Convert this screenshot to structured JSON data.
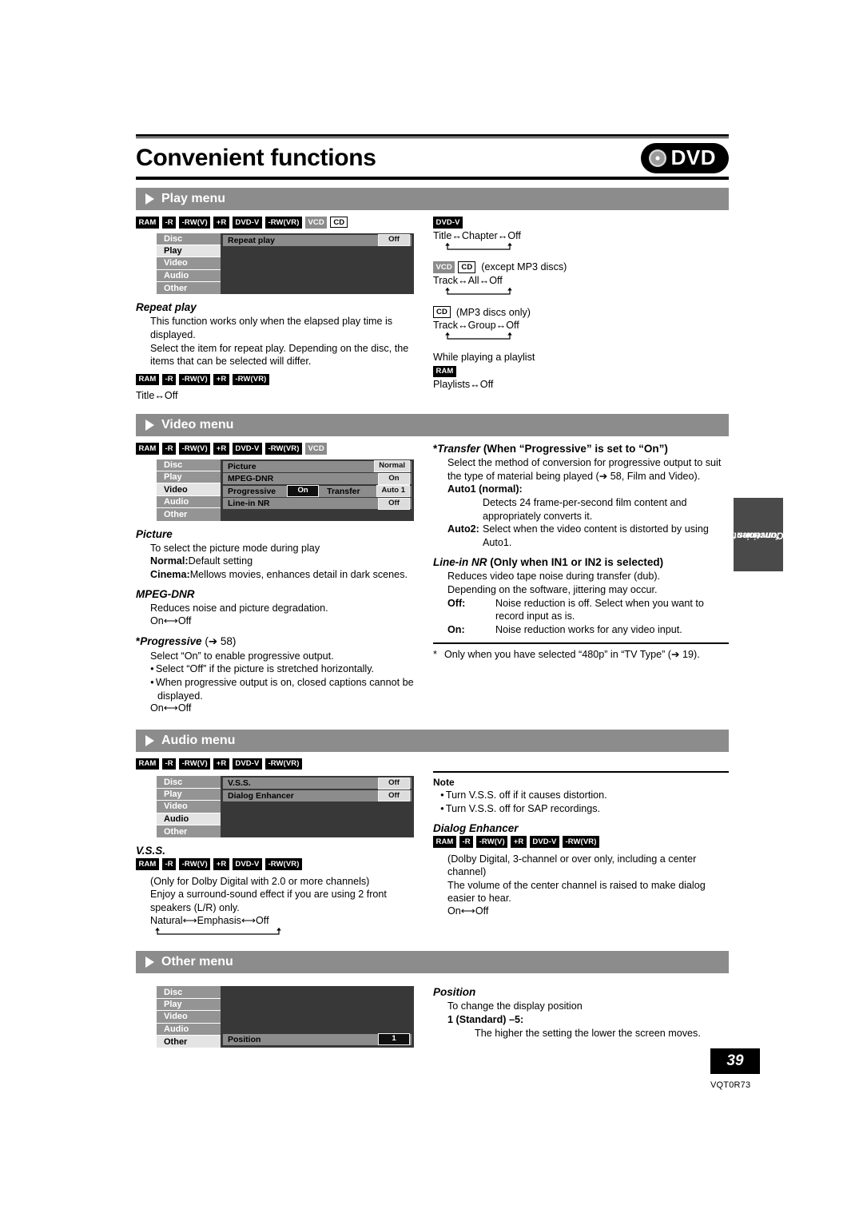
{
  "header": {
    "title": "Convenient functions",
    "logo_text": "DVD",
    "logo_icon": "disc-icon"
  },
  "badge_types": {
    "RAM": "dark",
    "-R": "dark",
    "-RW(V)": "dark",
    "+R": "dark",
    "DVD-V": "dark",
    "-RW(VR)": "dark",
    "VCD": "gray",
    "CD": "light"
  },
  "sections": [
    {
      "id": "play",
      "title": "Play menu",
      "badges": [
        "RAM",
        "-R",
        "-RW(V)",
        "+R",
        "DVD-V",
        "-RW(VR)",
        "VCD",
        "CD"
      ],
      "osd": {
        "tabs": [
          "Disc",
          "Play",
          "Video",
          "Audio",
          "Other"
        ],
        "active": "Play",
        "rows": [
          {
            "label": "Repeat play",
            "value": "Off",
            "value_style": "light"
          }
        ]
      },
      "left": {
        "term": "Repeat play",
        "paragraphs": [
          "This function works only when the elapsed play time is displayed.",
          "Select the item for repeat play. Depending on the disc, the items that can be selected will differ."
        ],
        "sub_badges": [
          "RAM",
          "-R",
          "-RW(V)",
          "+R",
          "-RW(VR)"
        ],
        "cycle": "Title↔Off"
      },
      "right": {
        "blocks": [
          {
            "badges": [
              "DVD-V"
            ],
            "note": "",
            "cycle": "Title↔Chapter↔Off",
            "loop": true
          },
          {
            "badges": [
              "VCD",
              "CD"
            ],
            "note": "(except MP3 discs)",
            "cycle": "Track↔All↔Off",
            "loop": true
          },
          {
            "badges": [
              "CD"
            ],
            "note": "(MP3 discs only)",
            "cycle": "Track↔Group↔Off",
            "loop": true
          },
          {
            "pretext": "While playing a playlist",
            "badges": [
              "RAM"
            ],
            "note": "",
            "cycle": "Playlists↔Off",
            "loop": false
          }
        ]
      }
    },
    {
      "id": "video",
      "title": "Video menu",
      "badges": [
        "RAM",
        "-R",
        "-RW(V)",
        "+R",
        "DVD-V",
        "-RW(VR)",
        "VCD"
      ],
      "osd": {
        "tabs": [
          "Disc",
          "Play",
          "Video",
          "Audio",
          "Other"
        ],
        "active": "Video",
        "rows": [
          {
            "label": "Picture",
            "value": "Normal",
            "value_style": "light"
          },
          {
            "label": "MPEG-DNR",
            "value": "On",
            "value_style": "light"
          },
          {
            "label": "Progressive",
            "value": "On",
            "value_style": "dark",
            "label2": "Transfer",
            "value2": "Auto 1",
            "value2_style": "light"
          },
          {
            "label": "Line-in NR",
            "value": "Off",
            "value_style": "light"
          }
        ]
      },
      "left": {
        "picture": {
          "term": "Picture",
          "intro": "To select the picture mode during play",
          "defs": [
            {
              "dt": "Normal:",
              "dd": "Default setting"
            },
            {
              "dt": "Cinema:",
              "dd": "Mellows movies, enhances detail in dark scenes."
            }
          ]
        },
        "mpeg": {
          "term": "MPEG-DNR",
          "text": "Reduces noise and picture degradation.",
          "cycle": "On⟷Off"
        },
        "progressive": {
          "term": "Progressive",
          "term_suffix": "(➔ 58)",
          "star": "*",
          "text": "Select “On” to enable progressive output.",
          "bullets": [
            "Select “Off” if the picture is stretched horizontally.",
            "When progressive output is on, closed captions cannot be displayed."
          ],
          "cycle": "On⟷Off"
        }
      },
      "right": {
        "transfer": {
          "star": "*",
          "term": "Transfer",
          "term_suffix": "(When “Progressive” is set to “On”)",
          "text": "Select the method of conversion for progressive output to suit the type of material being played (➔ 58, Film and Video).",
          "defs": [
            {
              "dt": "Auto1 (normal):",
              "dd": "Detects 24 frame-per-second film content and appropriately converts it.",
              "stacked": true
            },
            {
              "dt": "Auto2:",
              "dd": "Select when the video content is distorted by using Auto1.",
              "stacked": false
            }
          ]
        },
        "linein": {
          "term": "Line-in NR",
          "term_suffix": "(Only when IN1 or IN2 is selected)",
          "lines": [
            "Reduces video tape noise during transfer (dub).",
            "Depending on the software, jittering may occur."
          ],
          "defs": [
            {
              "dt": "Off:",
              "dd": "Noise reduction is off. Select when you want to record input as is."
            },
            {
              "dt": "On:",
              "dd": "Noise reduction works for any video input."
            }
          ]
        },
        "footnote": "Only when you have selected “480p” in “TV Type” (➔ 19).",
        "footnote_star": "*"
      }
    },
    {
      "id": "audio",
      "title": "Audio menu",
      "badges": [
        "RAM",
        "-R",
        "-RW(V)",
        "+R",
        "DVD-V",
        "-RW(VR)"
      ],
      "osd": {
        "tabs": [
          "Disc",
          "Play",
          "Video",
          "Audio",
          "Other"
        ],
        "active": "Audio",
        "rows": [
          {
            "label": "V.S.S.",
            "value": "Off",
            "value_style": "light"
          },
          {
            "label": "Dialog Enhancer",
            "value": "Off",
            "value_style": "light"
          }
        ]
      },
      "left": {
        "vss": {
          "term": "V.S.S.",
          "badges": [
            "RAM",
            "-R",
            "-RW(V)",
            "+R",
            "DVD-V",
            "-RW(VR)"
          ],
          "lines": [
            "(Only for Dolby Digital with 2.0 or more channels)",
            "Enjoy a surround-sound effect if you are using 2 front speakers (L/R) only."
          ],
          "cycle": "Natural⟷Emphasis⟷Off"
        }
      },
      "right": {
        "note": {
          "title": "Note",
          "bullets": [
            "Turn V.S.S. off if it causes distortion.",
            "Turn V.S.S. off for SAP recordings."
          ]
        },
        "dialog": {
          "term": "Dialog Enhancer",
          "badges": [
            "RAM",
            "-R",
            "-RW(V)",
            "+R",
            "DVD-V",
            "-RW(VR)"
          ],
          "lines": [
            "(Dolby Digital, 3-channel or over only, including a center channel)",
            "The volume of the center channel is raised to make dialog easier to hear."
          ],
          "cycle": "On⟷Off"
        }
      }
    },
    {
      "id": "other",
      "title": "Other menu",
      "badges": [],
      "osd": {
        "tabs": [
          "Disc",
          "Play",
          "Video",
          "Audio",
          "Other"
        ],
        "active": "Other",
        "rows": [
          {
            "label": "Position",
            "value": "1",
            "value_style": "dark"
          }
        ],
        "bottom_align": true
      },
      "right": {
        "position": {
          "term": "Position",
          "intro": "To change the display position",
          "def_dt": "1 (Standard) –5:",
          "def_dd": "The higher the setting the lower the screen moves."
        }
      }
    }
  ],
  "side_tab": {
    "line1": "Convenient",
    "line2": "functions"
  },
  "footer": {
    "page_number": "39",
    "doc_code": "VQT0R73"
  }
}
